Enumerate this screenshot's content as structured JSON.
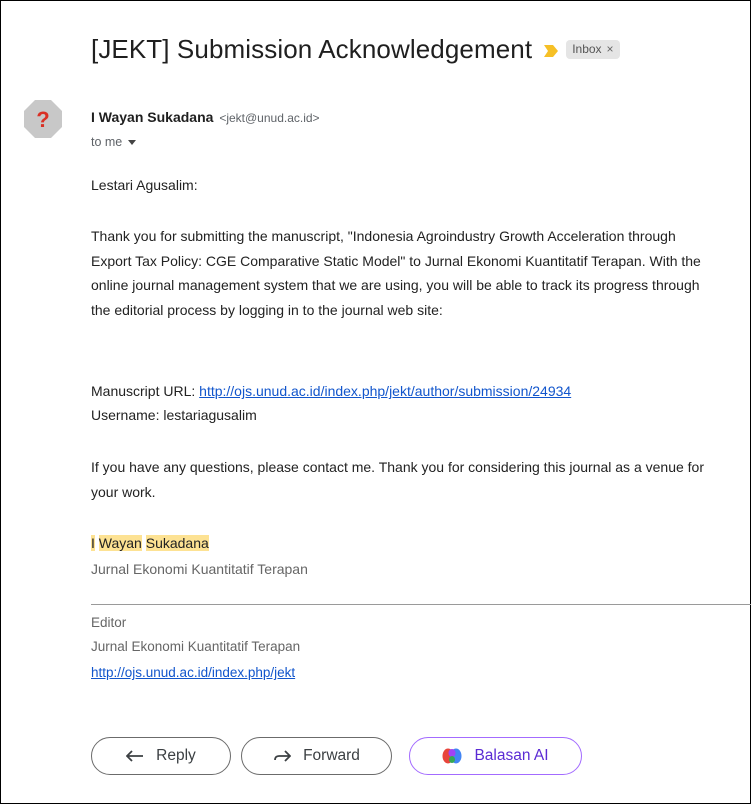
{
  "subject": "[JEKT] Submission Acknowledgement",
  "labels": [
    {
      "text": "Inbox",
      "close": "×"
    }
  ],
  "colors": {
    "importance": "#f6c026",
    "avatar": "#c8c8c8",
    "avatar_mark": "#d93025",
    "link": "#1155cc",
    "highlight": "#fde293",
    "ai_border": "#a36bff"
  },
  "sender": {
    "name": "I Wayan Sukadana",
    "email": "<jekt@unud.ac.id>",
    "avatar_glyph": "?"
  },
  "recipient": {
    "to": "to me"
  },
  "body": {
    "greeting": "Lestari Agusalim:",
    "para1": "Thank you for submitting the manuscript, \"Indonesia Agroindustry Growth Acceleration through Export Tax Policy: CGE Comparative Static Model\" to Jurnal Ekonomi Kuantitatif Terapan. With the online journal management system that we are using, you will be able to track its progress through the editorial process by logging in to the journal web site:",
    "manuscript_label": "Manuscript URL: ",
    "manuscript_url": "http://ojs.unud.ac.id/index.php/jekt/author/submission/24934",
    "username_line": "Username: lestariagusalim",
    "para2": "If you have any questions, please contact me. Thank you for considering this journal as a venue for your work.",
    "signature": {
      "name_part1": "I",
      "name_part2": "Wayan",
      "name_part3": "Sukadana",
      "journal": "Jurnal Ekonomi Kuantitatif Terapan"
    },
    "footer": {
      "role": "Editor",
      "journal": "Jurnal Ekonomi Kuantitatif Terapan",
      "url": "http://ojs.unud.ac.id/index.php/jekt"
    }
  },
  "actions": {
    "reply": "Reply",
    "forward": "Forward",
    "ai_reply": "Balasan AI"
  }
}
